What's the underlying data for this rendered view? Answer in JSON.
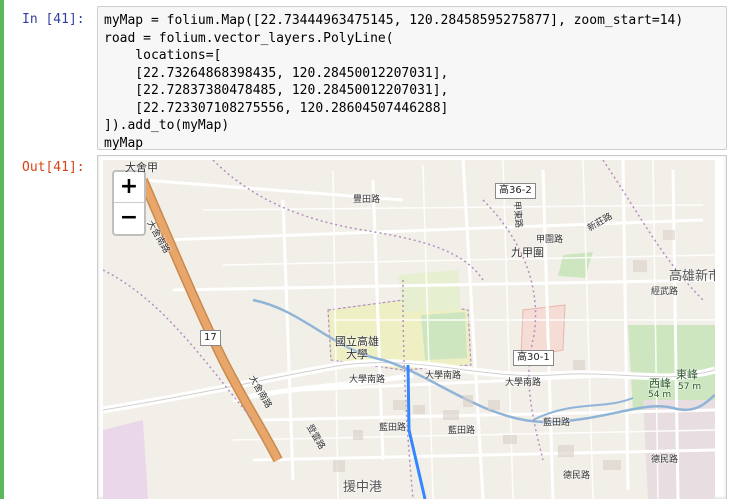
{
  "prompts": {
    "in": "In [41]:",
    "out": "Out[41]:"
  },
  "code_lines": [
    "myMap = folium.Map([22.73444963475145, 120.28458595275877], zoom_start=14)",
    "road = folium.vector_layers.PolyLine(",
    "    locations=[",
    "    [22.73264868398435, 120.28450012207031],",
    "    [22.72837380478485, 120.28450012207031],",
    "    [22.723307108275556, 120.28604507446288]",
    "]).add_to(myMap)",
    "myMap"
  ],
  "zoom": {
    "plus": "+",
    "minus": "−"
  },
  "colors": {
    "left_bar": "#5cb85c",
    "route": "#3388ff",
    "freeway": "#e8a66a",
    "park": "#cde6bf",
    "campus": "#eef0c4"
  },
  "map_labels": {
    "dashe": "大舍甲",
    "fengtian": "豐田路",
    "gao36": "高36-2",
    "jiujiayuan": "九甲圍",
    "jiayuan": "甲圍路",
    "xinzhuang": "新莊路",
    "jiadong": "甲東路",
    "kaohsiung_new": "高雄新市",
    "jingxue": "經武路",
    "route17": "17",
    "nsysu": "國立高雄\n大學",
    "daxue_south": "大學南路",
    "daxue_south2": "大學南路",
    "daxue_west": "大學南路",
    "gao30": "高30-1",
    "lanjian": "藍田路",
    "lanjian2": "藍田路",
    "lanjian3": "藍田路",
    "xifeng": "西峰",
    "dongfeng": "東峰",
    "elev54": "54 m",
    "elev57": "57 m",
    "yuanzhonggang": "援中港",
    "demin": "德民路",
    "demin2": "德民路",
    "dengyu": "登雲路",
    "dashe_road": "大舍南路",
    "dashe_road2": "大舍南路"
  }
}
